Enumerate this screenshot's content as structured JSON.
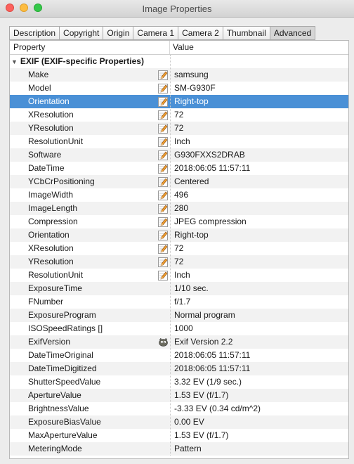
{
  "window": {
    "title": "Image Properties"
  },
  "tabs": [
    {
      "label": "Description"
    },
    {
      "label": "Copyright"
    },
    {
      "label": "Origin"
    },
    {
      "label": "Camera 1"
    },
    {
      "label": "Camera 2"
    },
    {
      "label": "Thumbnail"
    },
    {
      "label": "Advanced",
      "active": true
    }
  ],
  "table": {
    "col_property": "Property",
    "col_value": "Value",
    "group_label": "EXIF (EXIF-specific Properties)",
    "rows": [
      {
        "property": "Make",
        "value": "samsung",
        "icon": "pencil-icon"
      },
      {
        "property": "Model",
        "value": "SM-G930F",
        "icon": "pencil-icon"
      },
      {
        "property": "Orientation",
        "value": "Right-top",
        "icon": "pencil-icon",
        "selected": true
      },
      {
        "property": "XResolution",
        "value": "72",
        "icon": "pencil-icon"
      },
      {
        "property": "YResolution",
        "value": "72",
        "icon": "pencil-icon"
      },
      {
        "property": "ResolutionUnit",
        "value": "Inch",
        "icon": "pencil-icon"
      },
      {
        "property": "Software",
        "value": "G930FXXS2DRAB",
        "icon": "pencil-icon"
      },
      {
        "property": "DateTime",
        "value": "2018:06:05 11:57:11",
        "icon": "pencil-icon"
      },
      {
        "property": "YCbCrPositioning",
        "value": "Centered",
        "icon": "pencil-icon"
      },
      {
        "property": "ImageWidth",
        "value": "496",
        "icon": "pencil-icon"
      },
      {
        "property": "ImageLength",
        "value": "280",
        "icon": "pencil-icon"
      },
      {
        "property": "Compression",
        "value": "JPEG compression",
        "icon": "pencil-icon"
      },
      {
        "property": "Orientation",
        "value": "Right-top",
        "icon": "pencil-icon"
      },
      {
        "property": "XResolution",
        "value": "72",
        "icon": "pencil-icon"
      },
      {
        "property": "YResolution",
        "value": "72",
        "icon": "pencil-icon"
      },
      {
        "property": "ResolutionUnit",
        "value": "Inch",
        "icon": "pencil-icon"
      },
      {
        "property": "ExposureTime",
        "value": "1/10 sec.",
        "icon": ""
      },
      {
        "property": "FNumber",
        "value": "f/1.7",
        "icon": ""
      },
      {
        "property": "ExposureProgram",
        "value": "Normal program",
        "icon": ""
      },
      {
        "property": "ISOSpeedRatings []",
        "value": "1000",
        "icon": ""
      },
      {
        "property": "ExifVersion",
        "value": "Exif Version 2.2",
        "icon": "gimp-icon"
      },
      {
        "property": "DateTimeOriginal",
        "value": "2018:06:05 11:57:11",
        "icon": ""
      },
      {
        "property": "DateTimeDigitized",
        "value": "2018:06:05 11:57:11",
        "icon": ""
      },
      {
        "property": "ShutterSpeedValue",
        "value": "3.32 EV (1/9 sec.)",
        "icon": ""
      },
      {
        "property": "ApertureValue",
        "value": "1.53 EV (f/1.7)",
        "icon": ""
      },
      {
        "property": "BrightnessValue",
        "value": "-3.33 EV (0.34 cd/m^2)",
        "icon": ""
      },
      {
        "property": "ExposureBiasValue",
        "value": "0.00 EV",
        "icon": ""
      },
      {
        "property": "MaxApertureValue",
        "value": "1.53 EV (f/1.7)",
        "icon": ""
      },
      {
        "property": "MeteringMode",
        "value": "Pattern",
        "icon": ""
      }
    ]
  },
  "colors": {
    "selection": "#4a90d6",
    "alt_row": "#f2f2f2"
  }
}
